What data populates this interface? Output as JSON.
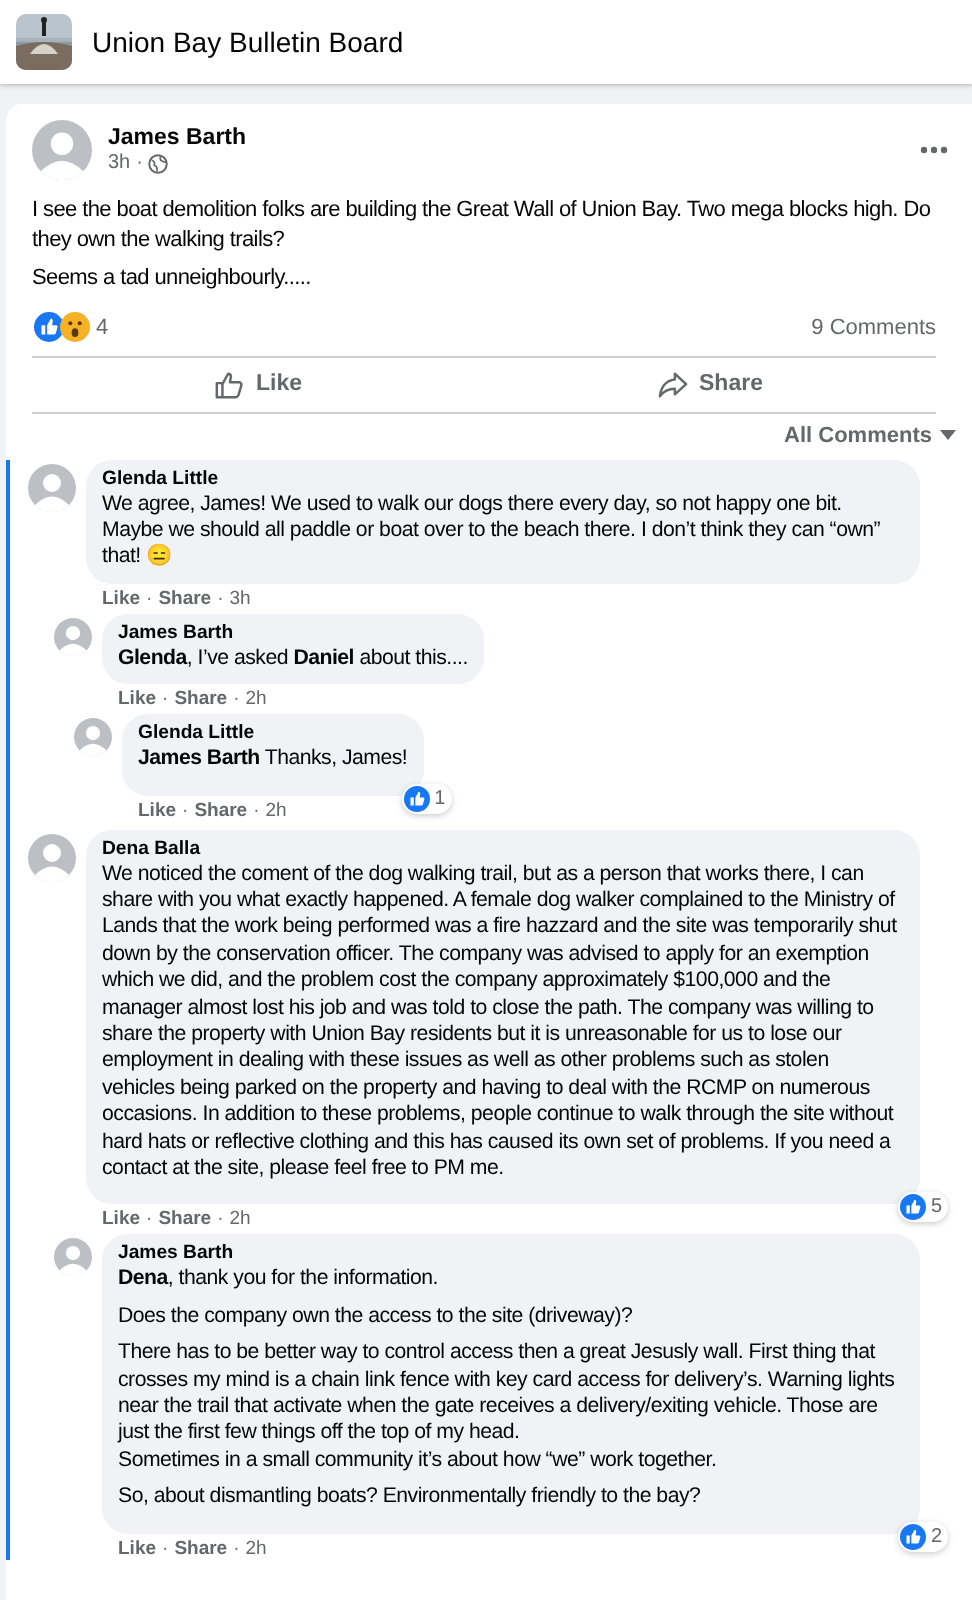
{
  "group": {
    "name": "Union Bay Bulletin Board",
    "kind": "picture"
  },
  "post": {
    "author": "James Barth",
    "time": "3h",
    "time_separator": "·",
    "paragraphs": [
      "I see the boat demolition folks are building the Great Wall of Union Bay. Two mega blocks high. Do they own the walking trails?",
      "Seems a tad unneighbourly....."
    ],
    "reaction_count": "4",
    "comment_count": "9 Comments",
    "actions": [
      "Like",
      "Share"
    ]
  },
  "comment_filter": "All Comments",
  "comments": [
    {
      "author": "Glenda Little",
      "paragraphs": [
        "We agree, James! We used to walk our dogs there every day, so not happy one bit. Maybe we should all paddle or boat over to the beach there. I don’t think they can “own” that! 😑"
      ],
      "meta": [
        "Like",
        "·",
        "Share",
        "·",
        "3h"
      ],
      "children": [
        {
          "author": "James Barth",
          "paragraphs": [
            "**Glenda**, I’ve asked **Daniel** about this...."
          ],
          "meta": [
            "Like",
            "·",
            "Share",
            "·",
            "2h"
          ],
          "children": [
            {
              "author": "Glenda Little",
              "paragraphs": [
                "**James Barth** Thanks, James!"
              ],
              "reaction_count": "1",
              "meta": [
                "Like",
                "·",
                "Share",
                "·",
                "2h"
              ]
            }
          ]
        }
      ]
    },
    {
      "author": "Dena Balla",
      "paragraphs": [
        "We noticed the coment of the dog walking trail, but as a person that works there, I can share with you what exactly happened. A female dog walker complained to the Ministry of Lands that the work being performed was a fire hazzard and the site was temporarily shut down by the conservation officer. The company was advised to apply for an exemption which we did, and the problem cost the company approximately $100,000 and the manager almost lost his job and was told to close the path. The company was willing to share the property with Union Bay residents but it is unreasonable for us to lose our employment in dealing with these issues as well as other problems such as stolen vehicles being parked on the property and having to deal with the RCMP on numerous occasions. In addition to these problems, people continue to walk through the site without hard hats or reflective clothing and this has caused its own set of problems. If you need a contact at the site, please feel free to PM me."
      ],
      "reaction_count": "5",
      "meta": [
        "Like",
        "·",
        "Share",
        "·",
        "2h"
      ],
      "children": [
        {
          "author": "James Barth",
          "paragraphs": [
            "**Dena**, thank you for the information.",
            "Does the company own the access to the site (driveway)?",
            "There has to be better way to control access then a great Jesusly wall. First thing that crosses my mind is a chain link fence with key card access for delivery’s. Warning lights near the trail that activate when the gate receives a delivery/exiting vehicle. Those are just the first few things off the top of my head.\nSometimes in a small community it’s about how “we” work together.",
            "So, about dismantling boats? Environmentally friendly to the bay?"
          ],
          "reaction_count": "2",
          "meta": [
            "Like",
            "·",
            "Share",
            "·",
            "2h"
          ]
        }
      ]
    }
  ]
}
